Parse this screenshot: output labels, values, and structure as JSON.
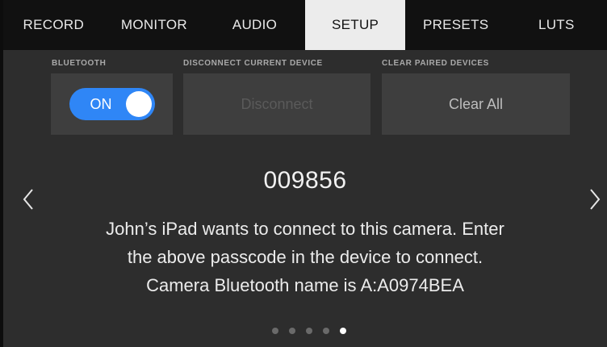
{
  "tabs": [
    {
      "label": "RECORD"
    },
    {
      "label": "MONITOR"
    },
    {
      "label": "AUDIO"
    },
    {
      "label": "SETUP",
      "active": true
    },
    {
      "label": "PRESETS"
    },
    {
      "label": "LUTS"
    }
  ],
  "bluetooth": {
    "label": "BLUETOOTH",
    "toggle_text": "ON",
    "state": "on",
    "color": "#2f86f6"
  },
  "disconnect": {
    "label": "DISCONNECT CURRENT DEVICE",
    "button": "Disconnect",
    "enabled": false
  },
  "clear": {
    "label": "CLEAR PAIRED DEVICES",
    "button": "Clear All",
    "enabled": true
  },
  "pairing": {
    "passcode": "009856",
    "message_lines": [
      "John’s iPad wants to connect to this camera. Enter",
      "the above passcode in the device to connect.",
      "Camera Bluetooth name is A:A0974BEA"
    ]
  },
  "nav": {
    "prev_icon": "chevron-left-icon",
    "next_icon": "chevron-right-icon"
  },
  "pagination": {
    "count": 5,
    "active": 5
  }
}
